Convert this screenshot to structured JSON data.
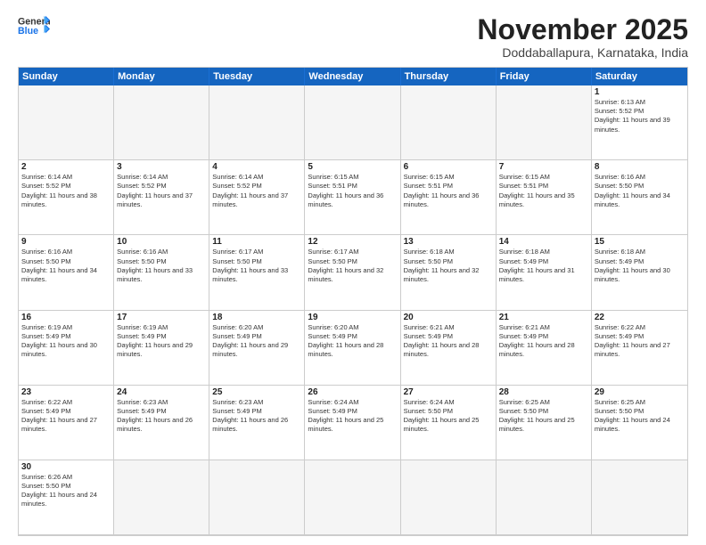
{
  "header": {
    "logo_general": "General",
    "logo_blue": "Blue",
    "month_title": "November 2025",
    "location": "Doddaballapura, Karnataka, India"
  },
  "weekdays": [
    "Sunday",
    "Monday",
    "Tuesday",
    "Wednesday",
    "Thursday",
    "Friday",
    "Saturday"
  ],
  "cells": [
    {
      "day": "",
      "empty": true,
      "sunrise": "",
      "sunset": "",
      "daylight": ""
    },
    {
      "day": "",
      "empty": true,
      "sunrise": "",
      "sunset": "",
      "daylight": ""
    },
    {
      "day": "",
      "empty": true,
      "sunrise": "",
      "sunset": "",
      "daylight": ""
    },
    {
      "day": "",
      "empty": true,
      "sunrise": "",
      "sunset": "",
      "daylight": ""
    },
    {
      "day": "",
      "empty": true,
      "sunrise": "",
      "sunset": "",
      "daylight": ""
    },
    {
      "day": "",
      "empty": true,
      "sunrise": "",
      "sunset": "",
      "daylight": ""
    },
    {
      "day": "1",
      "empty": false,
      "sunrise": "Sunrise: 6:13 AM",
      "sunset": "Sunset: 5:52 PM",
      "daylight": "Daylight: 11 hours and 39 minutes."
    },
    {
      "day": "2",
      "empty": false,
      "sunrise": "Sunrise: 6:14 AM",
      "sunset": "Sunset: 5:52 PM",
      "daylight": "Daylight: 11 hours and 38 minutes."
    },
    {
      "day": "3",
      "empty": false,
      "sunrise": "Sunrise: 6:14 AM",
      "sunset": "Sunset: 5:52 PM",
      "daylight": "Daylight: 11 hours and 37 minutes."
    },
    {
      "day": "4",
      "empty": false,
      "sunrise": "Sunrise: 6:14 AM",
      "sunset": "Sunset: 5:52 PM",
      "daylight": "Daylight: 11 hours and 37 minutes."
    },
    {
      "day": "5",
      "empty": false,
      "sunrise": "Sunrise: 6:15 AM",
      "sunset": "Sunset: 5:51 PM",
      "daylight": "Daylight: 11 hours and 36 minutes."
    },
    {
      "day": "6",
      "empty": false,
      "sunrise": "Sunrise: 6:15 AM",
      "sunset": "Sunset: 5:51 PM",
      "daylight": "Daylight: 11 hours and 36 minutes."
    },
    {
      "day": "7",
      "empty": false,
      "sunrise": "Sunrise: 6:15 AM",
      "sunset": "Sunset: 5:51 PM",
      "daylight": "Daylight: 11 hours and 35 minutes."
    },
    {
      "day": "8",
      "empty": false,
      "sunrise": "Sunrise: 6:16 AM",
      "sunset": "Sunset: 5:50 PM",
      "daylight": "Daylight: 11 hours and 34 minutes."
    },
    {
      "day": "9",
      "empty": false,
      "sunrise": "Sunrise: 6:16 AM",
      "sunset": "Sunset: 5:50 PM",
      "daylight": "Daylight: 11 hours and 34 minutes."
    },
    {
      "day": "10",
      "empty": false,
      "sunrise": "Sunrise: 6:16 AM",
      "sunset": "Sunset: 5:50 PM",
      "daylight": "Daylight: 11 hours and 33 minutes."
    },
    {
      "day": "11",
      "empty": false,
      "sunrise": "Sunrise: 6:17 AM",
      "sunset": "Sunset: 5:50 PM",
      "daylight": "Daylight: 11 hours and 33 minutes."
    },
    {
      "day": "12",
      "empty": false,
      "sunrise": "Sunrise: 6:17 AM",
      "sunset": "Sunset: 5:50 PM",
      "daylight": "Daylight: 11 hours and 32 minutes."
    },
    {
      "day": "13",
      "empty": false,
      "sunrise": "Sunrise: 6:18 AM",
      "sunset": "Sunset: 5:50 PM",
      "daylight": "Daylight: 11 hours and 32 minutes."
    },
    {
      "day": "14",
      "empty": false,
      "sunrise": "Sunrise: 6:18 AM",
      "sunset": "Sunset: 5:49 PM",
      "daylight": "Daylight: 11 hours and 31 minutes."
    },
    {
      "day": "15",
      "empty": false,
      "sunrise": "Sunrise: 6:18 AM",
      "sunset": "Sunset: 5:49 PM",
      "daylight": "Daylight: 11 hours and 30 minutes."
    },
    {
      "day": "16",
      "empty": false,
      "sunrise": "Sunrise: 6:19 AM",
      "sunset": "Sunset: 5:49 PM",
      "daylight": "Daylight: 11 hours and 30 minutes."
    },
    {
      "day": "17",
      "empty": false,
      "sunrise": "Sunrise: 6:19 AM",
      "sunset": "Sunset: 5:49 PM",
      "daylight": "Daylight: 11 hours and 29 minutes."
    },
    {
      "day": "18",
      "empty": false,
      "sunrise": "Sunrise: 6:20 AM",
      "sunset": "Sunset: 5:49 PM",
      "daylight": "Daylight: 11 hours and 29 minutes."
    },
    {
      "day": "19",
      "empty": false,
      "sunrise": "Sunrise: 6:20 AM",
      "sunset": "Sunset: 5:49 PM",
      "daylight": "Daylight: 11 hours and 28 minutes."
    },
    {
      "day": "20",
      "empty": false,
      "sunrise": "Sunrise: 6:21 AM",
      "sunset": "Sunset: 5:49 PM",
      "daylight": "Daylight: 11 hours and 28 minutes."
    },
    {
      "day": "21",
      "empty": false,
      "sunrise": "Sunrise: 6:21 AM",
      "sunset": "Sunset: 5:49 PM",
      "daylight": "Daylight: 11 hours and 28 minutes."
    },
    {
      "day": "22",
      "empty": false,
      "sunrise": "Sunrise: 6:22 AM",
      "sunset": "Sunset: 5:49 PM",
      "daylight": "Daylight: 11 hours and 27 minutes."
    },
    {
      "day": "23",
      "empty": false,
      "sunrise": "Sunrise: 6:22 AM",
      "sunset": "Sunset: 5:49 PM",
      "daylight": "Daylight: 11 hours and 27 minutes."
    },
    {
      "day": "24",
      "empty": false,
      "sunrise": "Sunrise: 6:23 AM",
      "sunset": "Sunset: 5:49 PM",
      "daylight": "Daylight: 11 hours and 26 minutes."
    },
    {
      "day": "25",
      "empty": false,
      "sunrise": "Sunrise: 6:23 AM",
      "sunset": "Sunset: 5:49 PM",
      "daylight": "Daylight: 11 hours and 26 minutes."
    },
    {
      "day": "26",
      "empty": false,
      "sunrise": "Sunrise: 6:24 AM",
      "sunset": "Sunset: 5:49 PM",
      "daylight": "Daylight: 11 hours and 25 minutes."
    },
    {
      "day": "27",
      "empty": false,
      "sunrise": "Sunrise: 6:24 AM",
      "sunset": "Sunset: 5:50 PM",
      "daylight": "Daylight: 11 hours and 25 minutes."
    },
    {
      "day": "28",
      "empty": false,
      "sunrise": "Sunrise: 6:25 AM",
      "sunset": "Sunset: 5:50 PM",
      "daylight": "Daylight: 11 hours and 25 minutes."
    },
    {
      "day": "29",
      "empty": false,
      "sunrise": "Sunrise: 6:25 AM",
      "sunset": "Sunset: 5:50 PM",
      "daylight": "Daylight: 11 hours and 24 minutes."
    },
    {
      "day": "30",
      "empty": false,
      "sunrise": "Sunrise: 6:26 AM",
      "sunset": "Sunset: 5:50 PM",
      "daylight": "Daylight: 11 hours and 24 minutes."
    },
    {
      "day": "",
      "empty": true,
      "sunrise": "",
      "sunset": "",
      "daylight": ""
    },
    {
      "day": "",
      "empty": true,
      "sunrise": "",
      "sunset": "",
      "daylight": ""
    },
    {
      "day": "",
      "empty": true,
      "sunrise": "",
      "sunset": "",
      "daylight": ""
    },
    {
      "day": "",
      "empty": true,
      "sunrise": "",
      "sunset": "",
      "daylight": ""
    },
    {
      "day": "",
      "empty": true,
      "sunrise": "",
      "sunset": "",
      "daylight": ""
    },
    {
      "day": "",
      "empty": true,
      "sunrise": "",
      "sunset": "",
      "daylight": ""
    }
  ]
}
